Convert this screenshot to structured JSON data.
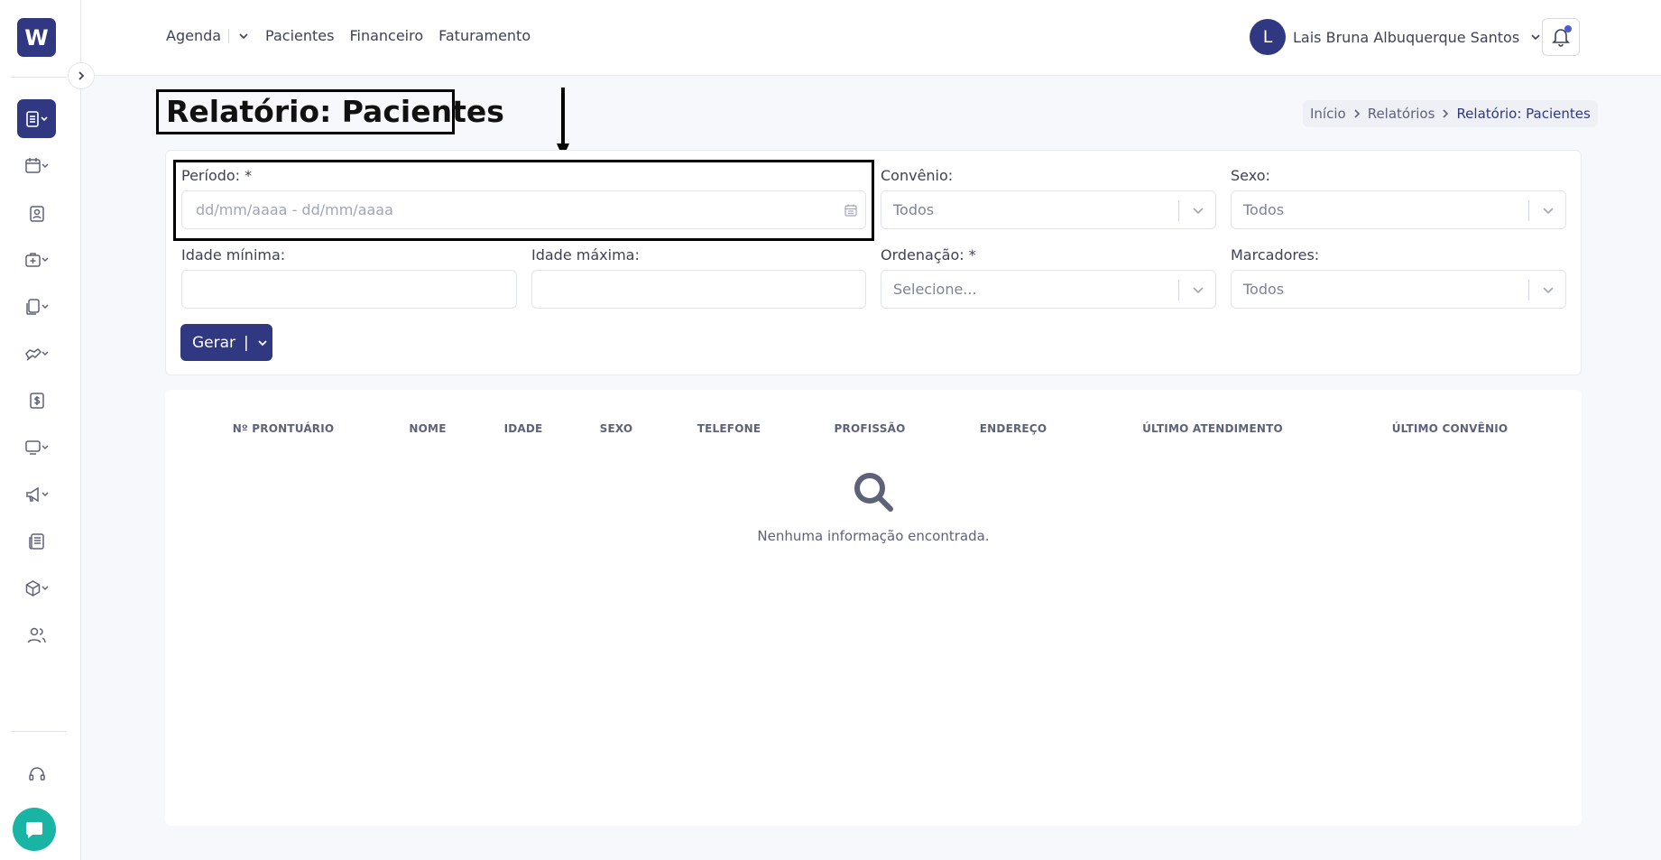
{
  "logo": {
    "letter": "W"
  },
  "header": {
    "nav": [
      {
        "label": "Agenda"
      },
      {
        "label": "Pacientes"
      },
      {
        "label": "Financeiro"
      },
      {
        "label": "Faturamento"
      }
    ],
    "user": {
      "initial": "L",
      "name": "Lais Bruna Albuquerque Santos"
    }
  },
  "page": {
    "title": "Relatório: Pacientes"
  },
  "breadcrumb": {
    "home": "Início",
    "section": "Relatórios",
    "current": "Relatório: Pacientes"
  },
  "filters": {
    "periodo": {
      "label": "Período: *",
      "placeholder": "dd/mm/aaaa - dd/mm/aaaa"
    },
    "convenio": {
      "label": "Convênio:",
      "value": "Todos"
    },
    "sexo": {
      "label": "Sexo:",
      "value": "Todos"
    },
    "idade_minima": {
      "label": "Idade mínima:",
      "value": ""
    },
    "idade_maxima": {
      "label": "Idade máxima:",
      "value": ""
    },
    "ordenacao": {
      "label": "Ordenação: *",
      "value": "Selecione..."
    },
    "marcadores": {
      "label": "Marcadores:",
      "value": "Todos"
    }
  },
  "actions": {
    "generate_label": "Gerar",
    "generate_separator": "|"
  },
  "table": {
    "columns": [
      "Nº PRONTUÁRIO",
      "NOME",
      "IDADE",
      "SEXO",
      "TELEFONE",
      "PROFISSÃO",
      "ENDEREÇO",
      "ÚLTIMO ATENDIMENTO",
      "ÚLTIMO CONVÊNIO"
    ],
    "empty_message": "Nenhuma informação encontrada."
  },
  "colors": {
    "primary": "#2f3880",
    "chat": "#1ab4a4",
    "notification_dot": "#4f5bd5"
  },
  "sidebar_icons": [
    "reports-icon",
    "calendar-icon",
    "patient-icon",
    "medical-icon",
    "documents-icon",
    "handshake-icon",
    "finance-icon",
    "monitor-icon",
    "megaphone-icon",
    "newspaper-icon",
    "box-icon",
    "users-icon",
    "support-icon",
    "chat-icon"
  ]
}
